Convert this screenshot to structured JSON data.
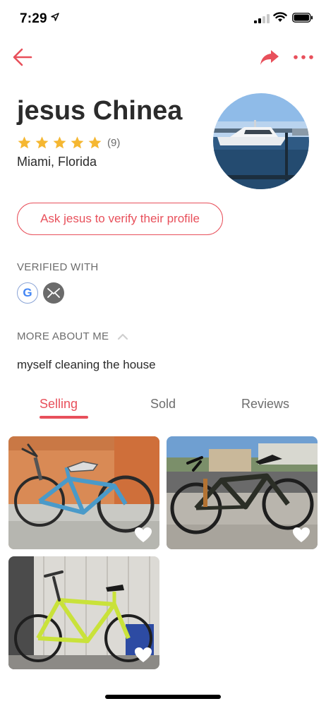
{
  "status_bar": {
    "time": "7:29"
  },
  "profile": {
    "name": "jesus Chinea",
    "rating_stars": 5,
    "review_count": "(9)",
    "location": "Miami, Florida",
    "verify_button": "Ask jesus to verify their profile"
  },
  "verified": {
    "heading": "VERIFIED WITH",
    "google_letter": "G",
    "icons": [
      "google-icon",
      "email-icon"
    ]
  },
  "about": {
    "heading": "MORE ABOUT ME",
    "text": "myself cleaning the house"
  },
  "tabs": [
    {
      "label": "Selling",
      "active": true
    },
    {
      "label": "Sold",
      "active": false
    },
    {
      "label": "Reviews",
      "active": false
    }
  ],
  "listings": [
    {
      "subject": "blue mountain bike against orange wall",
      "favorited": false
    },
    {
      "subject": "dark mountain bike on sidewalk",
      "favorited": false
    },
    {
      "subject": "yellow-green road bike in garage",
      "favorited": false
    }
  ],
  "colors": {
    "accent": "#e8505b",
    "star": "#f5b731",
    "text": "#2b2b2b",
    "muted": "#6d6d6d"
  }
}
